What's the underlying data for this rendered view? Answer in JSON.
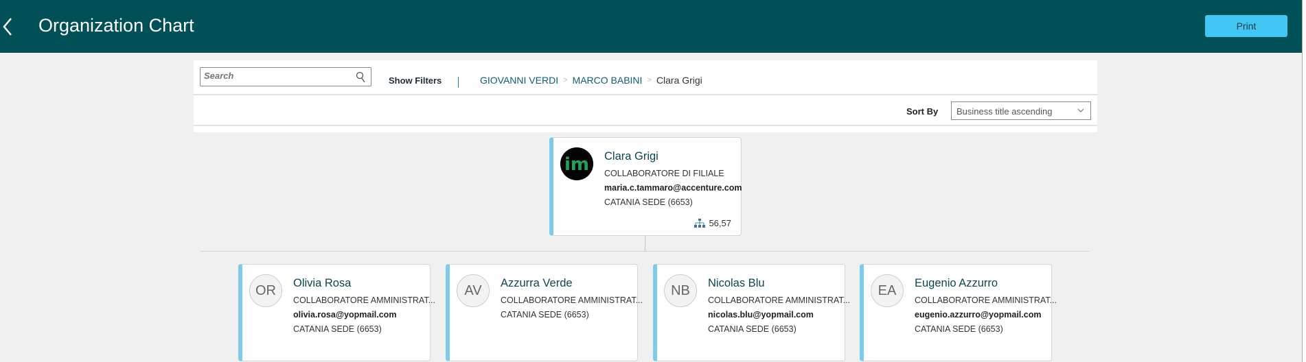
{
  "header": {
    "title": "Organization Chart",
    "print_label": "Print"
  },
  "toolbar": {
    "search_placeholder": "Search",
    "show_filters": "Show Filters",
    "breadcrumb": [
      "GIOVANNI VERDI",
      "MARCO BABINI",
      "Clara Grigi"
    ],
    "sort_label": "Sort By",
    "sort_value": "Business title ascending"
  },
  "colors": {
    "header": "#014f57",
    "accent": "#42c6f3",
    "card_border": "#7dcaeb"
  },
  "root": {
    "name": "Clara Grigi",
    "title": "COLLABORATORE DI FILIALE",
    "email": "maria.c.tammaro@accenture.com",
    "location": "CATANIA SEDE (6653)",
    "reports": "56,57",
    "avatar_text": "im"
  },
  "children": [
    {
      "initials": "OR",
      "name": "Olivia Rosa",
      "title": "COLLABORATORE AMMINISTRAT...",
      "email": "olivia.rosa@yopmail.com",
      "location": "CATANIA SEDE (6653)"
    },
    {
      "initials": "AV",
      "name": "Azzurra Verde",
      "title": "COLLABORATORE AMMINISTRAT...",
      "location": "CATANIA SEDE (6653)"
    },
    {
      "initials": "NB",
      "name": "Nicolas Blu",
      "title": "COLLABORATORE AMMINISTRAT...",
      "email": "nicolas.blu@yopmail.com",
      "location": "CATANIA SEDE (6653)"
    },
    {
      "initials": "EA",
      "name": "Eugenio Azzurro",
      "title": "COLLABORATORE AMMINISTRAT...",
      "email": "eugenio.azzurro@yopmail.com",
      "location": "CATANIA SEDE (6653)"
    }
  ]
}
